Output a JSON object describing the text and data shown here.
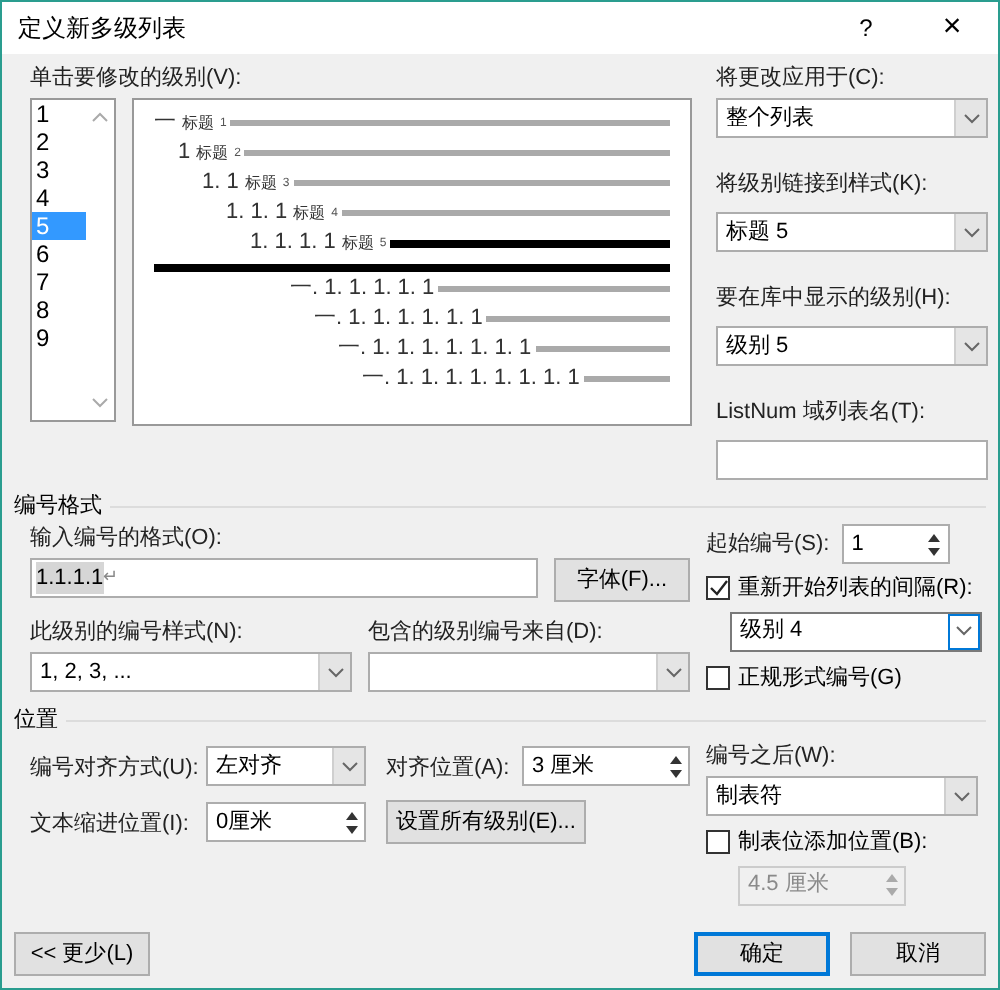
{
  "window": {
    "title": "定义新多级列表",
    "help": "?",
    "close": "×"
  },
  "level_list": {
    "label": "单击要修改的级别(V):",
    "items": [
      {
        "text": "1",
        "selected": false
      },
      {
        "text": "2",
        "selected": false
      },
      {
        "text": "3",
        "selected": false
      },
      {
        "text": "4",
        "selected": false
      },
      {
        "text": "5",
        "selected": true
      },
      {
        "text": "6",
        "selected": false
      },
      {
        "text": "7",
        "selected": false
      },
      {
        "text": "8",
        "selected": false
      },
      {
        "text": "9",
        "selected": false
      }
    ]
  },
  "preview": [
    {
      "number": "一",
      "caption": "标题",
      "caption_index": "1",
      "selected": false
    },
    {
      "number": "1",
      "caption": "标题",
      "caption_index": "2",
      "selected": false
    },
    {
      "number": "1. 1",
      "caption": "标题",
      "caption_index": "3",
      "selected": false
    },
    {
      "number": "1. 1. 1",
      "caption": "标题",
      "caption_index": "4",
      "selected": false
    },
    {
      "number": "1. 1. 1. 1",
      "caption": "标题",
      "caption_index": "5",
      "selected": true
    },
    {
      "number": "一. 1. 1. 1. 1. 1",
      "selected": false
    },
    {
      "number": "一. 1. 1. 1. 1. 1. 1",
      "selected": false
    },
    {
      "number": "一. 1. 1. 1. 1. 1. 1. 1",
      "selected": false
    },
    {
      "number": "一. 1. 1. 1. 1. 1. 1. 1. 1",
      "selected": false
    }
  ],
  "apply_to": {
    "label": "将更改应用于(C):",
    "value": "整个列表"
  },
  "link_style": {
    "label": "将级别链接到样式(K):",
    "value": "标题 5"
  },
  "gallery_level": {
    "label": "要在库中显示的级别(H):",
    "value": "级别 5"
  },
  "listnum": {
    "label": "ListNum 域列表名(T):"
  },
  "number_format": {
    "title": "编号格式",
    "format_label": "输入编号的格式(O):",
    "format_value": "1.1.1.1",
    "paragraph_mark": "↵",
    "font_button": "字体(F)...",
    "style_label": "此级别的编号样式(N):",
    "style_value": "1, 2, 3, ...",
    "include_label": "包含的级别编号来自(D):",
    "start_label": "起始编号(S):",
    "start_value": "1",
    "restart": {
      "label": "重新开始列表的间隔(R):",
      "checked": true
    },
    "restart_value": "级别 4",
    "legal": {
      "label": "正规形式编号(G)",
      "checked": false
    }
  },
  "position": {
    "title": "位置",
    "align_label": "编号对齐方式(U):",
    "align_value": "左对齐",
    "at_label": "对齐位置(A):",
    "at_value": "3 厘米",
    "indent_label": "文本缩进位置(I):",
    "indent_value": "0厘米",
    "set_all_button": "设置所有级别(E)...",
    "follow_label": "编号之后(W):",
    "follow_value": "制表符",
    "tab_stop": {
      "label": "制表位添加位置(B):",
      "checked": false
    },
    "tab_value": "4.5 厘米",
    "tab_disabled": true
  },
  "buttons": {
    "less": "<< 更少(L)",
    "ok": "确定",
    "cancel": "取消"
  }
}
